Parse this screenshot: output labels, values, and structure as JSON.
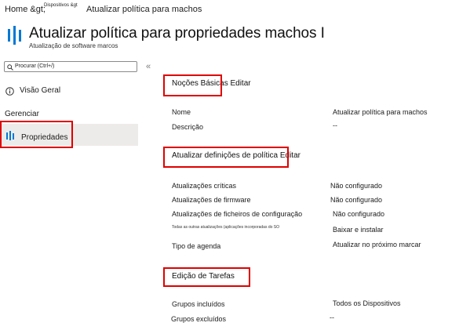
{
  "breadcrumb": {
    "home": "Home &gt;",
    "devices": "Dispositivos &gt",
    "current": "Atualizar política para machos"
  },
  "header": {
    "title": "Atualizar política para propriedades machos I",
    "subtitle": "Atualização de software marcos"
  },
  "sidebar": {
    "search_placeholder": "Procurar (Ctrl+/)",
    "collapse_glyph": "«",
    "overview_label": "Visão Geral",
    "manage_label": "Gerenciar",
    "properties_label": "Propriedades"
  },
  "sections": {
    "basics": {
      "title": "Noções Básicas Editar",
      "rows": [
        {
          "label": "Nome",
          "value": "Atualizar política para machos"
        },
        {
          "label": "Descrição",
          "value": "--"
        }
      ]
    },
    "settings": {
      "title": "Atualizar definições de política Editar",
      "rows": [
        {
          "label": "Atualizações críticas",
          "value": "Não configurado"
        },
        {
          "label": "Atualizações de firmware",
          "value": "Não configurado"
        },
        {
          "label": "Atualizações de ficheiros de configuração",
          "value": "Não configurado"
        },
        {
          "label": "Todas as outras atualizações (aplicações incorporadas do SO",
          "value": "Baixar e instalar"
        },
        {
          "label": "Tipo de agenda",
          "value": "Atualizar no próximo marcar"
        }
      ]
    },
    "tasks": {
      "title": "Edição de Tarefas",
      "rows": [
        {
          "label": "Grupos incluídos",
          "value": "Todos os Dispositivos"
        },
        {
          "label": "Grupos excluídos",
          "value": "--"
        }
      ]
    }
  },
  "colors": {
    "highlight": "#e00000",
    "selected_bg": "#edebe9",
    "icon_blue": "#0078d4"
  }
}
